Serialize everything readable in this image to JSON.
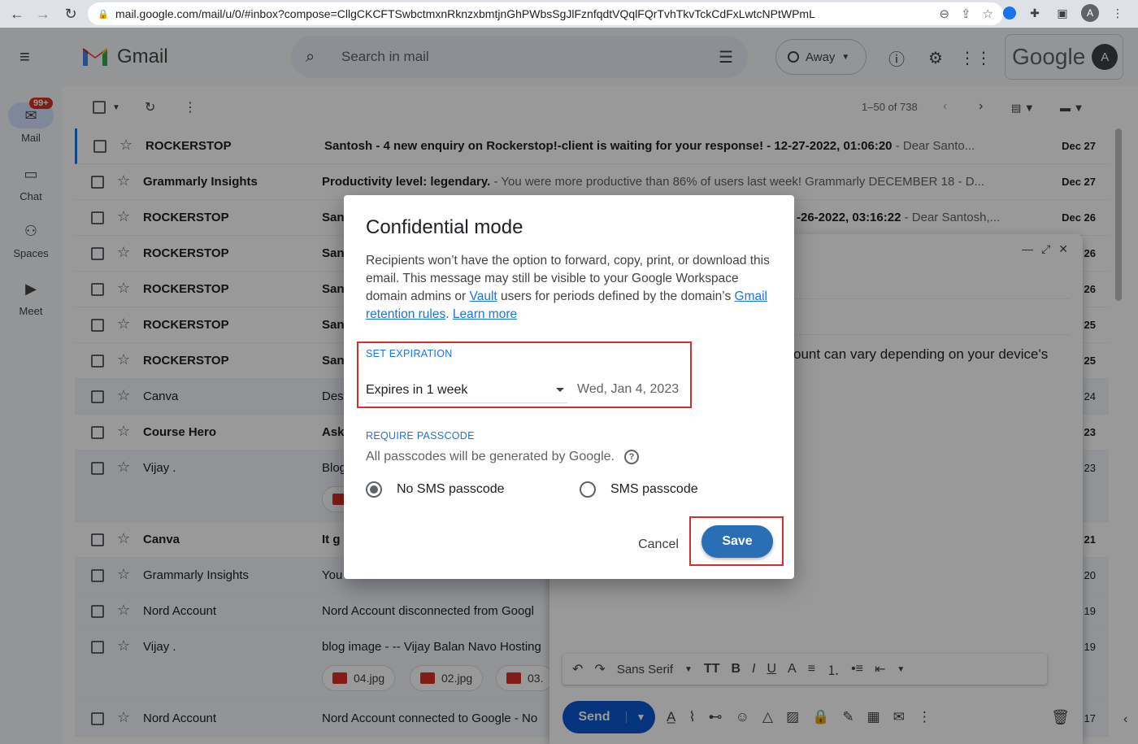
{
  "browser": {
    "url": "mail.google.com/mail/u/0/#inbox?compose=CllgCKCFTSwbctmxnRknzxbmtjnGhPWbsSgJlFznfqdtVQqlFQrTvhTkvTckCdFxLwtcNPtWPmL",
    "profile_initial": "A"
  },
  "header": {
    "app_name": "Gmail",
    "search_placeholder": "Search in mail",
    "status_label": "Away",
    "brand_word": "Google",
    "avatar_initial": "A"
  },
  "rail": {
    "items": [
      {
        "label": "Mail",
        "badge": "99+"
      },
      {
        "label": "Chat"
      },
      {
        "label": "Spaces"
      },
      {
        "label": "Meet"
      }
    ]
  },
  "toolbar": {
    "page_count": "1–50 of 738"
  },
  "emails": [
    {
      "sender": "ROCKERSTOP",
      "subject": "Santosh - 4 new enquiry on Rockerstop!-client is waiting for your response! - 12-27-2022, 01:06:20",
      "snippet": " - Dear Santo...",
      "date": "Dec 27"
    },
    {
      "sender": "Grammarly Insights",
      "subject": "Productivity level: legendary.",
      "snippet": " - You were more productive than 86% of users last week! Grammarly DECEMBER 18 - D...",
      "date": "Dec 27"
    },
    {
      "sender": "ROCKERSTOP",
      "subject": "San",
      "subject_tail": "-26-2022, 03:16:22",
      "snippet": " - Dear Santosh,...",
      "date": "Dec 26"
    },
    {
      "sender": "ROCKERSTOP",
      "subject": "San",
      "date": "26"
    },
    {
      "sender": "ROCKERSTOP",
      "subject": "San",
      "date": "26"
    },
    {
      "sender": "ROCKERSTOP",
      "subject": "San",
      "date": "25"
    },
    {
      "sender": "ROCKERSTOP",
      "subject": "San",
      "date": "25"
    },
    {
      "sender": "Canva",
      "subject": "Des",
      "date": "24"
    },
    {
      "sender": "Course Hero",
      "subject": "Ask",
      "date": "23"
    },
    {
      "sender": "Vijay .",
      "subject": "Blog",
      "date": "23"
    },
    {
      "sender": "Canva",
      "subject": "It g",
      "date": "21"
    },
    {
      "sender": "Grammarly Insights",
      "subject": "You",
      "date": "20"
    },
    {
      "sender": "Nord Account",
      "subject": "Nord Account disconnected from Googl",
      "date": "19"
    },
    {
      "sender": "Vijay .",
      "subject": "blog image - -- Vijay Balan Navo Hosting",
      "date": "19",
      "attachments": [
        "04.jpg",
        "02.jpg",
        "03."
      ]
    },
    {
      "sender": "Nord Account",
      "subject": "Nord Account connected to Google - No",
      "date": "17"
    }
  ],
  "compose": {
    "body_visible": "ount can vary depending on your device's",
    "font_name": "Sans Serif",
    "send_label": "Send"
  },
  "dialog": {
    "title": "Confidential mode",
    "desc_1": "Recipients won’t have the option to forward, copy, print, or download this email. This message may still be visible to your Google Workspace domain admins or ",
    "link_vault": "Vault",
    "desc_2": " users for periods defined by the domain’s ",
    "link_retention": "Gmail retention rules",
    "desc_3": ". ",
    "link_learn": "Learn more",
    "set_expiration": "SET EXPIRATION",
    "expiry_value": "Expires in 1 week",
    "expiry_date": "Wed, Jan 4, 2023",
    "require_passcode": "REQUIRE PASSCODE",
    "passcode_note": "All passcodes will be generated by Google.",
    "radio_no_sms": "No SMS passcode",
    "radio_sms": "SMS passcode",
    "cancel_label": "Cancel",
    "save_label": "Save",
    "highlight_color": "#d32f2f",
    "save_color": "#2a6eb5"
  }
}
